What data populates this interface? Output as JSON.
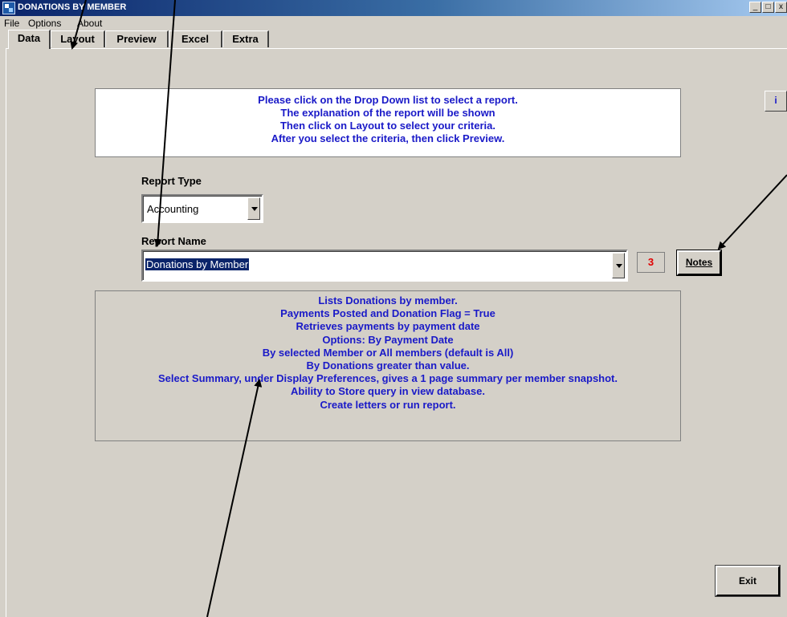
{
  "window": {
    "title": "DONATIONS BY MEMBER",
    "controls": [
      "_",
      "□",
      "x"
    ]
  },
  "menu": [
    "File",
    "Options",
    "About"
  ],
  "tabs": [
    {
      "label": "Data",
      "active": true
    },
    {
      "label": "Layout",
      "active": false
    },
    {
      "label": "Preview",
      "active": false
    },
    {
      "label": "Excel",
      "active": false
    },
    {
      "label": "Extra",
      "active": false
    }
  ],
  "instructions": [
    "Please click on the Drop Down list to select a report.",
    "The explanation of the report will be shown",
    "Then click on Layout to select your criteria.",
    "After you select the criteria, then click Preview."
  ],
  "info_button": "i",
  "report_type": {
    "label": "Report Type",
    "value": "Accounting"
  },
  "report_name": {
    "label": "Report Name",
    "value": "Donations by Member"
  },
  "notes_count": "3",
  "notes_button": "Notes",
  "explanation": [
    "Lists Donations by member.",
    "Payments Posted and Donation Flag = True",
    "Retrieves payments by payment date",
    "Options: By Payment Date",
    "By selected Member or All members (default is All)",
    "By Donations greater than value.",
    "Select Summary, under Display Preferences, gives a 1 page summary per member snapshot.",
    "Ability to Store query in view database.",
    "Create letters or run report."
  ],
  "exit_button": "Exit",
  "colors": {
    "text_blue": "#1a1ac8",
    "count_red": "#e00000",
    "window_bg": "#d4d0c8",
    "title_bar": "#0a246a"
  }
}
